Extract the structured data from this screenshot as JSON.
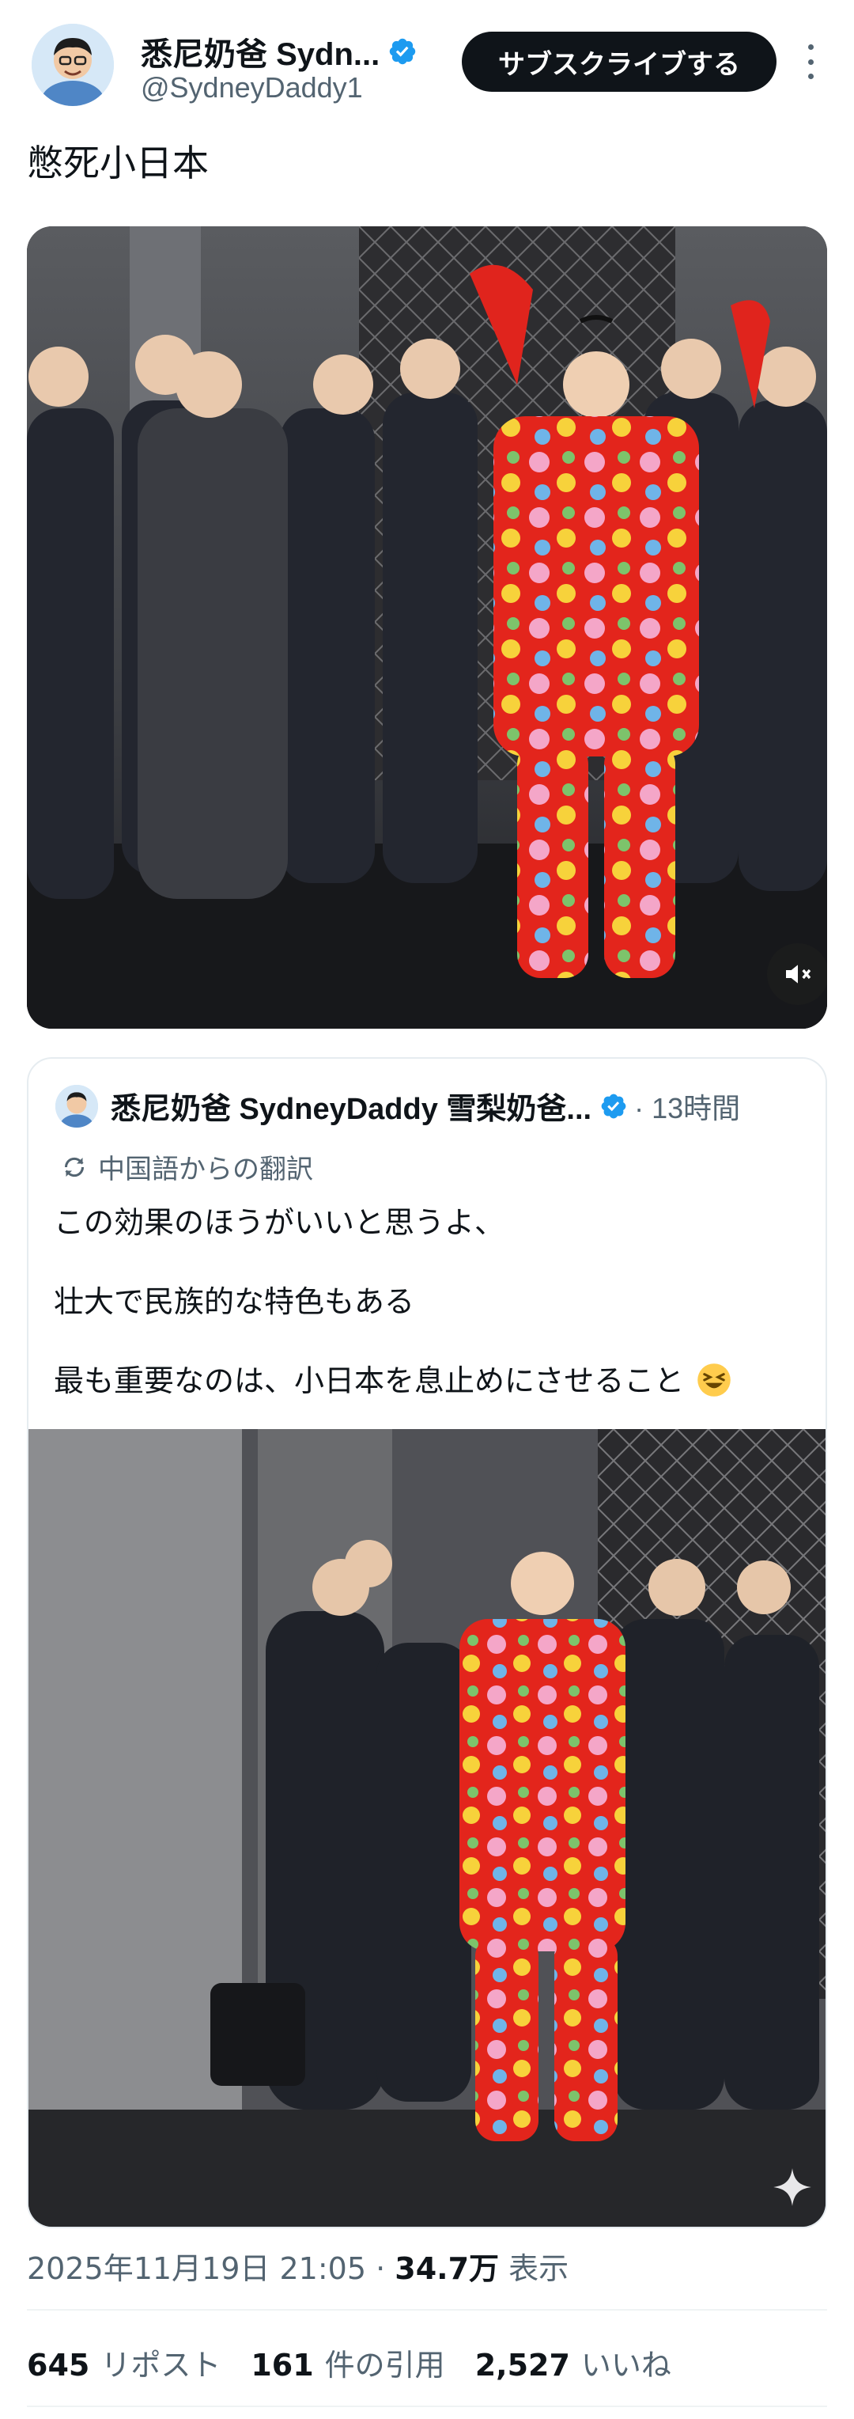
{
  "author": {
    "name": "悉尼奶爸 Sydn...",
    "handle": "@SydneyDaddy1",
    "verified": true
  },
  "subscribe_label": "サブスクライブする",
  "post_text": "憋死小日本",
  "media": {
    "type": "video",
    "mute_icon": "speaker-muted-icon"
  },
  "quote": {
    "author_name": "悉尼奶爸 SydneyDaddy 雪梨奶爸...",
    "time": "· 13時間",
    "translation_label": "中国語からの翻訳",
    "lines": [
      "この効果のほうがいいと思うよ、",
      "壮大で民族的な特色もある",
      "最も重要なのは、小日本を息止めにさせること"
    ],
    "emoji": "laughing-face-icon",
    "image_badge": "sparkle-icon"
  },
  "meta": {
    "timestamp": "2025年11月19日 21:05",
    "separator": " · ",
    "views_count": "34.7万",
    "views_label": " 表示"
  },
  "stats": {
    "reposts": {
      "count": "645",
      "label": "リポスト"
    },
    "quotes": {
      "count": "161",
      "label": "件の引用"
    },
    "likes": {
      "count": "2,527",
      "label": "いいね"
    }
  },
  "colors": {
    "accent_verified": "#1d9bf0",
    "text_primary": "#0f1419",
    "text_secondary": "#536471",
    "button_bg": "#0f1419"
  }
}
